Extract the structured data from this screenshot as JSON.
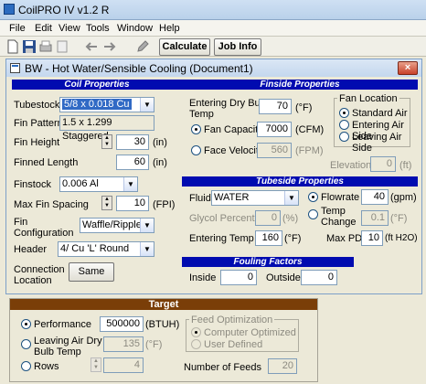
{
  "app": {
    "title": "CoilPRO IV v1.2 R"
  },
  "menu": [
    "File",
    "Edit",
    "View",
    "Tools",
    "Window",
    "Help"
  ],
  "toolbar": {
    "calculate_label": "Calculate",
    "jobinfo_label": "Job Info"
  },
  "document": {
    "title": "BW - Hot Water/Sensible Cooling (Document1)",
    "close_label": "×"
  },
  "coil": {
    "header": "Coil Properties",
    "tubestock_label": "Tubestock",
    "tubestock_value": "5/8 x 0.018 Cu",
    "finpattern_label": "Fin Pattern",
    "finpattern_value": "1.5 x 1.299 Staggered",
    "finheight_label": "Fin Height",
    "finheight_value": "30",
    "finheight_unit": "(in)",
    "finnedlength_label": "Finned Length",
    "finnedlength_value": "60",
    "finnedlength_unit": "(in)",
    "finstock_label": "Finstock",
    "finstock_value": "0.006 Al",
    "maxfin_label": "Max Fin Spacing",
    "maxfin_value": "10",
    "maxfin_unit": "(FPI)",
    "finconfig_label1": "Fin",
    "finconfig_label2": "Configuration",
    "finconfig_value": "Waffle/Ripple",
    "header_label": "Header",
    "header_value": "4/ Cu 'L' Round",
    "conn_label1": "Connection",
    "conn_label2": "Location",
    "conn_button": "Same"
  },
  "finside": {
    "header": "Finside Properties",
    "edb_label1": "Entering Dry Bulb",
    "edb_label2": "Temp",
    "edb_value": "70",
    "edb_unit": "(°F)",
    "fancap_label": "Fan Capacity",
    "fancap_value": "7000",
    "fancap_unit": "(CFM)",
    "facevel_label": "Face Velocity",
    "facevel_value": "560",
    "facevel_unit": "(FPM)",
    "fanloc_title": "Fan Location",
    "fanloc_opts": [
      "Standard Air",
      "Entering Air Side",
      "Leaving Air Side"
    ],
    "elev_label": "Elevation",
    "elev_value": "0",
    "elev_unit": "(ft)"
  },
  "tubeside": {
    "header": "Tubeside Properties",
    "fluid_label": "Fluid",
    "fluid_value": "WATER",
    "flowrate_label": "Flowrate",
    "flowrate_value": "40",
    "flowrate_unit": "(gpm)",
    "glycol_label": "Glycol Percent",
    "glycol_value": "0",
    "glycol_unit": "(%)",
    "tempchange_label1": "Temp",
    "tempchange_label2": "Change",
    "tempchange_value": "0.1",
    "tempchange_unit": "(°F)",
    "entemp_label": "Entering Temp",
    "entemp_value": "160",
    "entemp_unit": "(°F)",
    "maxpd_label": "Max PD",
    "maxpd_value": "10",
    "maxpd_unit": "(ft H2O)"
  },
  "fouling": {
    "header": "Fouling Factors",
    "inside_label": "Inside",
    "inside_value": "0",
    "outside_label": "Outside",
    "outside_value": "0"
  },
  "target": {
    "header": "Target",
    "perf_label": "Performance",
    "perf_value": "500000",
    "perf_unit": "(BTUH)",
    "ladb_label1": "Leaving Air Dry",
    "ladb_label2": "Bulb Temp",
    "ladb_value": "135",
    "ladb_unit": "(°F)",
    "rows_label": "Rows",
    "rows_value": "4"
  },
  "feed": {
    "title": "Feed Optimization",
    "opts": [
      "Computer Optimized",
      "User Defined"
    ],
    "numfeeds_label": "Number of Feeds",
    "numfeeds_value": "20"
  }
}
